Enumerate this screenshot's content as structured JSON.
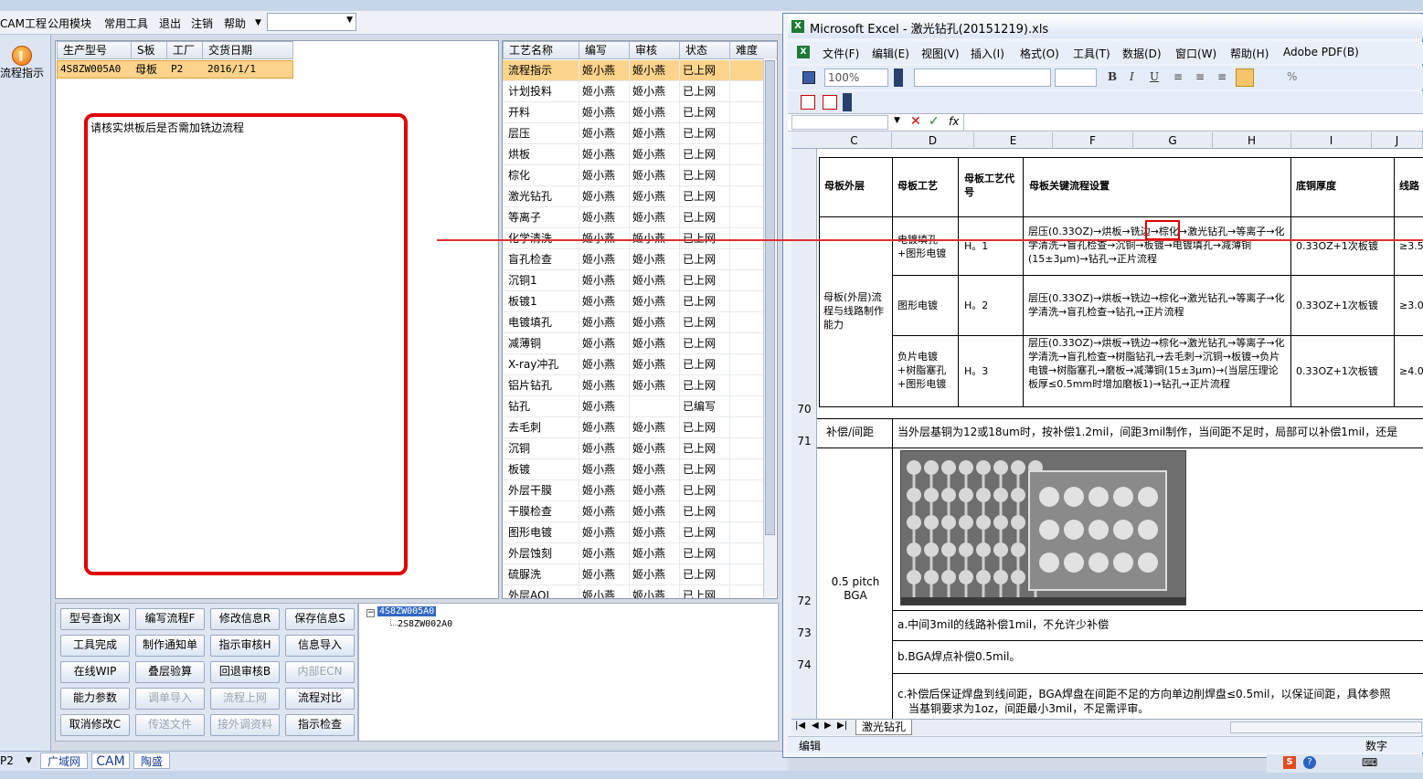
{
  "app": {
    "menu": [
      "CAM工程",
      "公用模块",
      "常用工具",
      "退出",
      "注销",
      "帮助"
    ],
    "sidebar_button": "流程指示",
    "info_table": {
      "headers": [
        "生产型号",
        "S板",
        "工厂",
        "交货日期"
      ],
      "row": [
        "4S8ZW005A0",
        "母板",
        "P2",
        "2016/1/1"
      ]
    },
    "alert_text": "请核实烘板后是否需加铣边流程",
    "flow_table": {
      "headers": [
        "工艺名称",
        "编写",
        "审核",
        "状态",
        "难度"
      ],
      "rows": [
        [
          "流程指示",
          "姬小燕",
          "姬小燕",
          "已上网"
        ],
        [
          "计划投料",
          "姬小燕",
          "姬小燕",
          "已上网"
        ],
        [
          "开料",
          "姬小燕",
          "姬小燕",
          "已上网"
        ],
        [
          "层压",
          "姬小燕",
          "姬小燕",
          "已上网"
        ],
        [
          "烘板",
          "姬小燕",
          "姬小燕",
          "已上网"
        ],
        [
          "棕化",
          "姬小燕",
          "姬小燕",
          "已上网"
        ],
        [
          "激光钻孔",
          "姬小燕",
          "姬小燕",
          "已上网"
        ],
        [
          "等离子",
          "姬小燕",
          "姬小燕",
          "已上网"
        ],
        [
          "化学清洗",
          "姬小燕",
          "姬小燕",
          "已上网"
        ],
        [
          "盲孔检查",
          "姬小燕",
          "姬小燕",
          "已上网"
        ],
        [
          "沉铜1",
          "姬小燕",
          "姬小燕",
          "已上网"
        ],
        [
          "板镀1",
          "姬小燕",
          "姬小燕",
          "已上网"
        ],
        [
          "电镀填孔",
          "姬小燕",
          "姬小燕",
          "已上网"
        ],
        [
          "减薄铜",
          "姬小燕",
          "姬小燕",
          "已上网"
        ],
        [
          "X-ray冲孔",
          "姬小燕",
          "姬小燕",
          "已上网"
        ],
        [
          "铝片钻孔",
          "姬小燕",
          "姬小燕",
          "已上网"
        ],
        [
          "钻孔",
          "姬小燕",
          "",
          "已编写"
        ],
        [
          "去毛刺",
          "姬小燕",
          "姬小燕",
          "已上网"
        ],
        [
          "沉铜",
          "姬小燕",
          "姬小燕",
          "已上网"
        ],
        [
          "板镀",
          "姬小燕",
          "姬小燕",
          "已上网"
        ],
        [
          "外层干膜",
          "姬小燕",
          "姬小燕",
          "已上网"
        ],
        [
          "干膜检查",
          "姬小燕",
          "姬小燕",
          "已上网"
        ],
        [
          "图形电镀",
          "姬小燕",
          "姬小燕",
          "已上网"
        ],
        [
          "外层蚀刻",
          "姬小燕",
          "姬小燕",
          "已上网"
        ],
        [
          "硫脲洗",
          "姬小燕",
          "姬小燕",
          "已上网"
        ],
        [
          "外层AOI",
          "姬小燕",
          "姬小燕",
          "已上网"
        ]
      ]
    },
    "buttons": [
      [
        "型号查询X",
        "编写流程F",
        "修改信息R",
        "保存信息S"
      ],
      [
        "工具完成",
        "制作通知单",
        "指示审核H",
        "信息导入"
      ],
      [
        "在线WIP",
        "叠层验算",
        "回退审核B",
        "内部ECN"
      ],
      [
        "能力参数",
        "调单导入",
        "流程上网",
        "流程对比"
      ],
      [
        "取消修改C",
        "传送文件",
        "接外调资料",
        "指示检查"
      ]
    ],
    "disabled_buttons": [
      "内部ECN",
      "调单导入",
      "流程上网",
      "传送文件",
      "接外调资料"
    ],
    "tree": [
      "4S8ZW005A0",
      "2S8ZW002A0"
    ],
    "bottom": {
      "factory": "P2",
      "tabs": [
        "广域网",
        "CAM",
        "陶盛"
      ]
    }
  },
  "excel": {
    "title": "Microsoft Excel - 激光钻孔(20151219).xls",
    "menu": [
      "文件(F)",
      "编辑(E)",
      "视图(V)",
      "插入(I)",
      "格式(O)",
      "工具(T)",
      "数据(D)",
      "窗口(W)",
      "帮助(H)",
      "Adobe PDF(B)"
    ],
    "zoom": "100%",
    "columns": [
      "C",
      "D",
      "E",
      "F",
      "G",
      "H",
      "I",
      "J"
    ],
    "rows": [
      "70",
      "71",
      "72",
      "73",
      "74"
    ],
    "table": {
      "headers": [
        "母板外层",
        "母板工艺",
        "母板工艺代号",
        "母板关键流程设置",
        "底铜厚度",
        "线路"
      ],
      "group_label": "母板(外层)流程与线路制作能力",
      "entries": [
        {
          "process": "电镀填孔+图形电镀",
          "code": "H。1",
          "flow_a": "层压(0.33OZ)→烘板→",
          "flow_hl": "铣边",
          "flow_b": "→棕化→激光钻孔→等离子→化学清洗→盲孔检查→沉铜→板镀→电镀填孔→减薄铜(15±3μm)→钻孔→正片流程",
          "cu": "0.33OZ+1次板镀",
          "line": "≥3.5"
        },
        {
          "process": "图形电镀",
          "code": "H。2",
          "flow_a": "层压(0.33OZ)→烘板→铣边→棕化→激光钻孔→等离子→化学清洗→盲孔检查→钻孔→正片流程",
          "flow_hl": "",
          "flow_b": "",
          "cu": "0.33OZ+1次板镀",
          "line": "≥3.0"
        },
        {
          "process": "负片电镀+树脂塞孔+图形电镀",
          "code": "H。3",
          "flow_a": "层压(0.33OZ)→烘板→铣边→棕化→激光钻孔→等离子→化学清洗→盲孔检查→树脂钻孔→去毛刺→沉铜→板镀→负片电镀→树脂塞孔→磨板→减薄铜(15±3μm)→(当层压理论板厚≤0.5mm时增加磨板1)→钻孔→正片流程",
          "flow_hl": "",
          "flow_b": "",
          "cu": "0.33OZ+1次板镀",
          "line": "≥4.0"
        }
      ],
      "row71_label": "补偿/间距",
      "row71_text": "当外层基铜为12或18um时，按补偿1.2mil，间距3mil制作，当间距不足时，局部可以补偿1mil，还是",
      "row72_label": "0.5 pitch BGA",
      "row73_text": "a.中间3mil的线路补偿1mil，不允许少补偿",
      "row74_text": "b.BGA焊点补偿0.5mil。",
      "row75_text_1": "c.补偿后保证焊盘到线间距，BGA焊盘在间距不足的方向单边削焊盘≤0.5mil，以保证间距，具体参照",
      "row75_text_2": "当基铜要求为1oz，间距最小3mil，不足需评审。"
    },
    "sheet_tab": "激光钻孔",
    "status_left": "编辑",
    "status_right": "数字"
  },
  "colors": {
    "accent_red": "#e00000",
    "selected_row": "#fbd38a",
    "grid_line": "#000000"
  }
}
